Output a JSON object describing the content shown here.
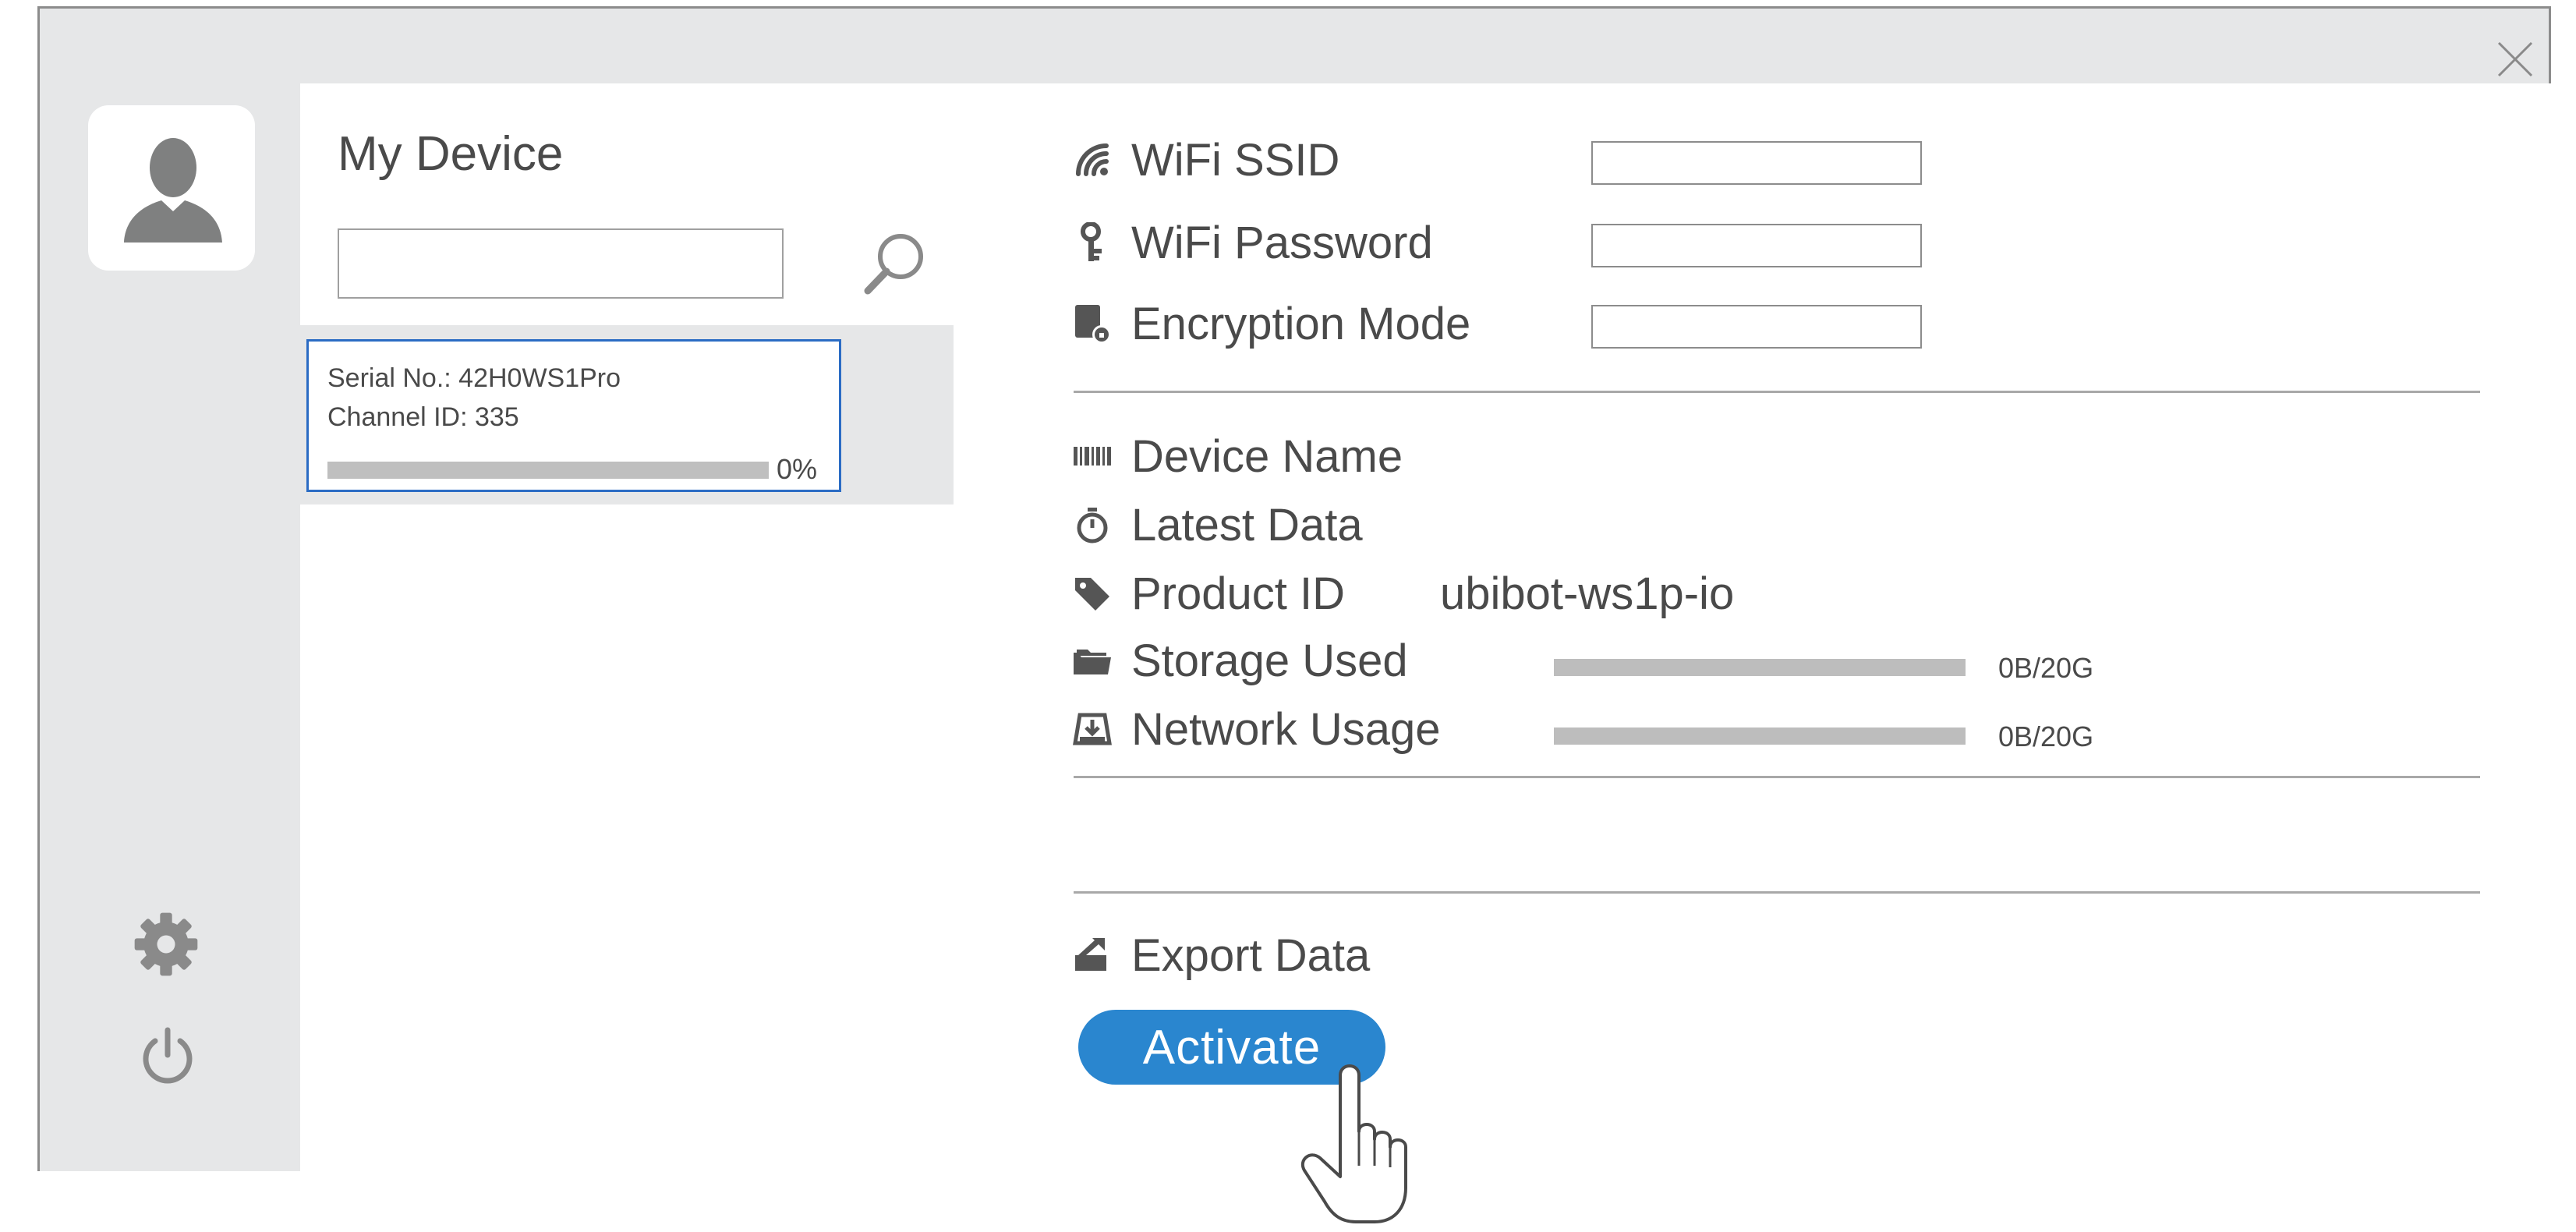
{
  "sidebar": {
    "avatar_icon": "user-avatar-icon",
    "settings_icon": "gear-icon",
    "power_icon": "power-icon"
  },
  "device_list": {
    "title": "My Device",
    "search": {
      "value": "",
      "placeholder": ""
    },
    "devices": [
      {
        "serial": "Serial No.: 42H0WS1Pro",
        "channel": "Channel ID: 335",
        "progress_label": "0%",
        "progress_fraction": 0
      }
    ]
  },
  "wifi": {
    "ssid_label": "WiFi SSID",
    "ssid_value": "",
    "password_label": "WiFi Password",
    "password_value": "",
    "encryption_label": "Encryption Mode",
    "encryption_value": ""
  },
  "device_info": {
    "device_name_label": "Device Name",
    "latest_data_label": "Latest Data",
    "product_id_label": "Product ID",
    "product_id_value": "ubibot-ws1p-io",
    "storage_label": "Storage Used",
    "storage_value": "0B/20G",
    "storage_fraction": 0,
    "network_label": "Network Usage",
    "network_value": "0B/20G",
    "network_fraction": 0
  },
  "actions": {
    "export_label": "Export Data",
    "activate_label": "Activate"
  },
  "colors": {
    "accent": "#2a86cf",
    "selection_border": "#2b6cc4",
    "panel_gray": "#e6e7e8"
  }
}
